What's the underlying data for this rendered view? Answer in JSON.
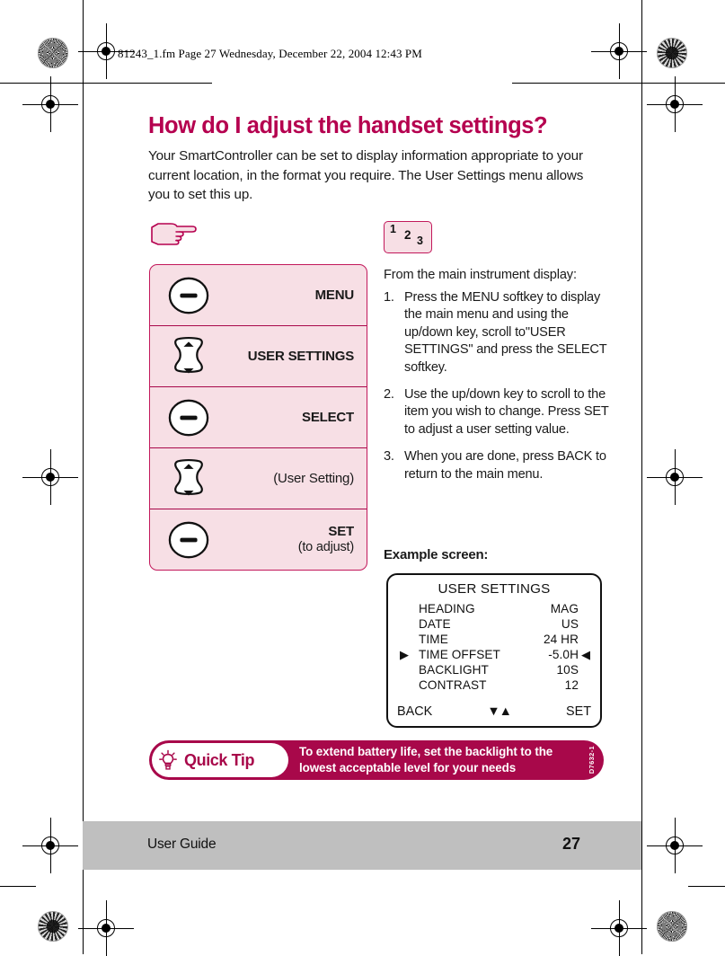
{
  "print_marks": {
    "file_info": "81243_1.fm  Page 27  Wednesday, December 22, 2004  12:43 PM"
  },
  "content": {
    "title": "How do I adjust the handset settings?",
    "intro": "Your SmartController can be set to display information appropriate to your current location, in the format you require. The User Settings menu allows you to set this up.",
    "hand_icon": "pointing-hand-icon",
    "badge": {
      "n1": "1",
      "n2": "2",
      "n3": "3"
    }
  },
  "key_panel": {
    "rows": [
      {
        "art": "softkey-button",
        "label": "MENU",
        "sublabel": "",
        "bold": true
      },
      {
        "art": "updown-key",
        "label": "USER SETTINGS",
        "sublabel": "",
        "bold": true
      },
      {
        "art": "softkey-button",
        "label": "SELECT",
        "sublabel": "",
        "bold": true
      },
      {
        "art": "updown-key",
        "label": "(User Setting)",
        "sublabel": "",
        "bold": false
      },
      {
        "art": "softkey-button",
        "label": "SET",
        "sublabel": "(to adjust)",
        "bold": true
      }
    ]
  },
  "instructions": {
    "lead": "From the main instrument display:",
    "steps": [
      {
        "num": "1.",
        "text": "Press the MENU softkey to display the main menu and using the up/down key, scroll to\"USER SETTINGS\" and press the SELECT softkey."
      },
      {
        "num": "2.",
        "text": "Use the up/down key to scroll to the item you wish to change. Press SET to adjust a user setting value."
      },
      {
        "num": "3.",
        "text": " When you are done, press BACK to return to the main menu."
      }
    ],
    "example_heading": "Example screen:"
  },
  "lcd": {
    "title": "USER SETTINGS",
    "rows": [
      {
        "caret_left": "",
        "name": "HEADING",
        "value": "MAG",
        "caret_right": ""
      },
      {
        "caret_left": "",
        "name": "DATE",
        "value": "US",
        "caret_right": ""
      },
      {
        "caret_left": "",
        "name": "TIME",
        "value": "24 HR",
        "caret_right": ""
      },
      {
        "caret_left": "▶",
        "name": "TIME OFFSET",
        "value": "-5.0H",
        "caret_right": "◀"
      },
      {
        "caret_left": "",
        "name": "BACKLIGHT",
        "value": "10S",
        "caret_right": ""
      },
      {
        "caret_left": "",
        "name": "CONTRAST",
        "value": "12",
        "caret_right": ""
      }
    ],
    "softkey_left": "BACK",
    "softkey_middle": "▼▲",
    "softkey_right": "SET"
  },
  "quick_tip": {
    "icon": "lightbulb-icon",
    "title": "Quick Tip",
    "body": "To extend battery life, set the backlight to the lowest acceptable level for your needs",
    "code": "D7632-1"
  },
  "footer": {
    "left": "User Guide",
    "page_number": "27"
  },
  "colors": {
    "crimson": "#b5004f",
    "deep_crimson": "#a8084a",
    "panel_pink": "#f7dfe5",
    "panel_border": "#c2185b",
    "footer_gray": "#bfbfbf"
  }
}
